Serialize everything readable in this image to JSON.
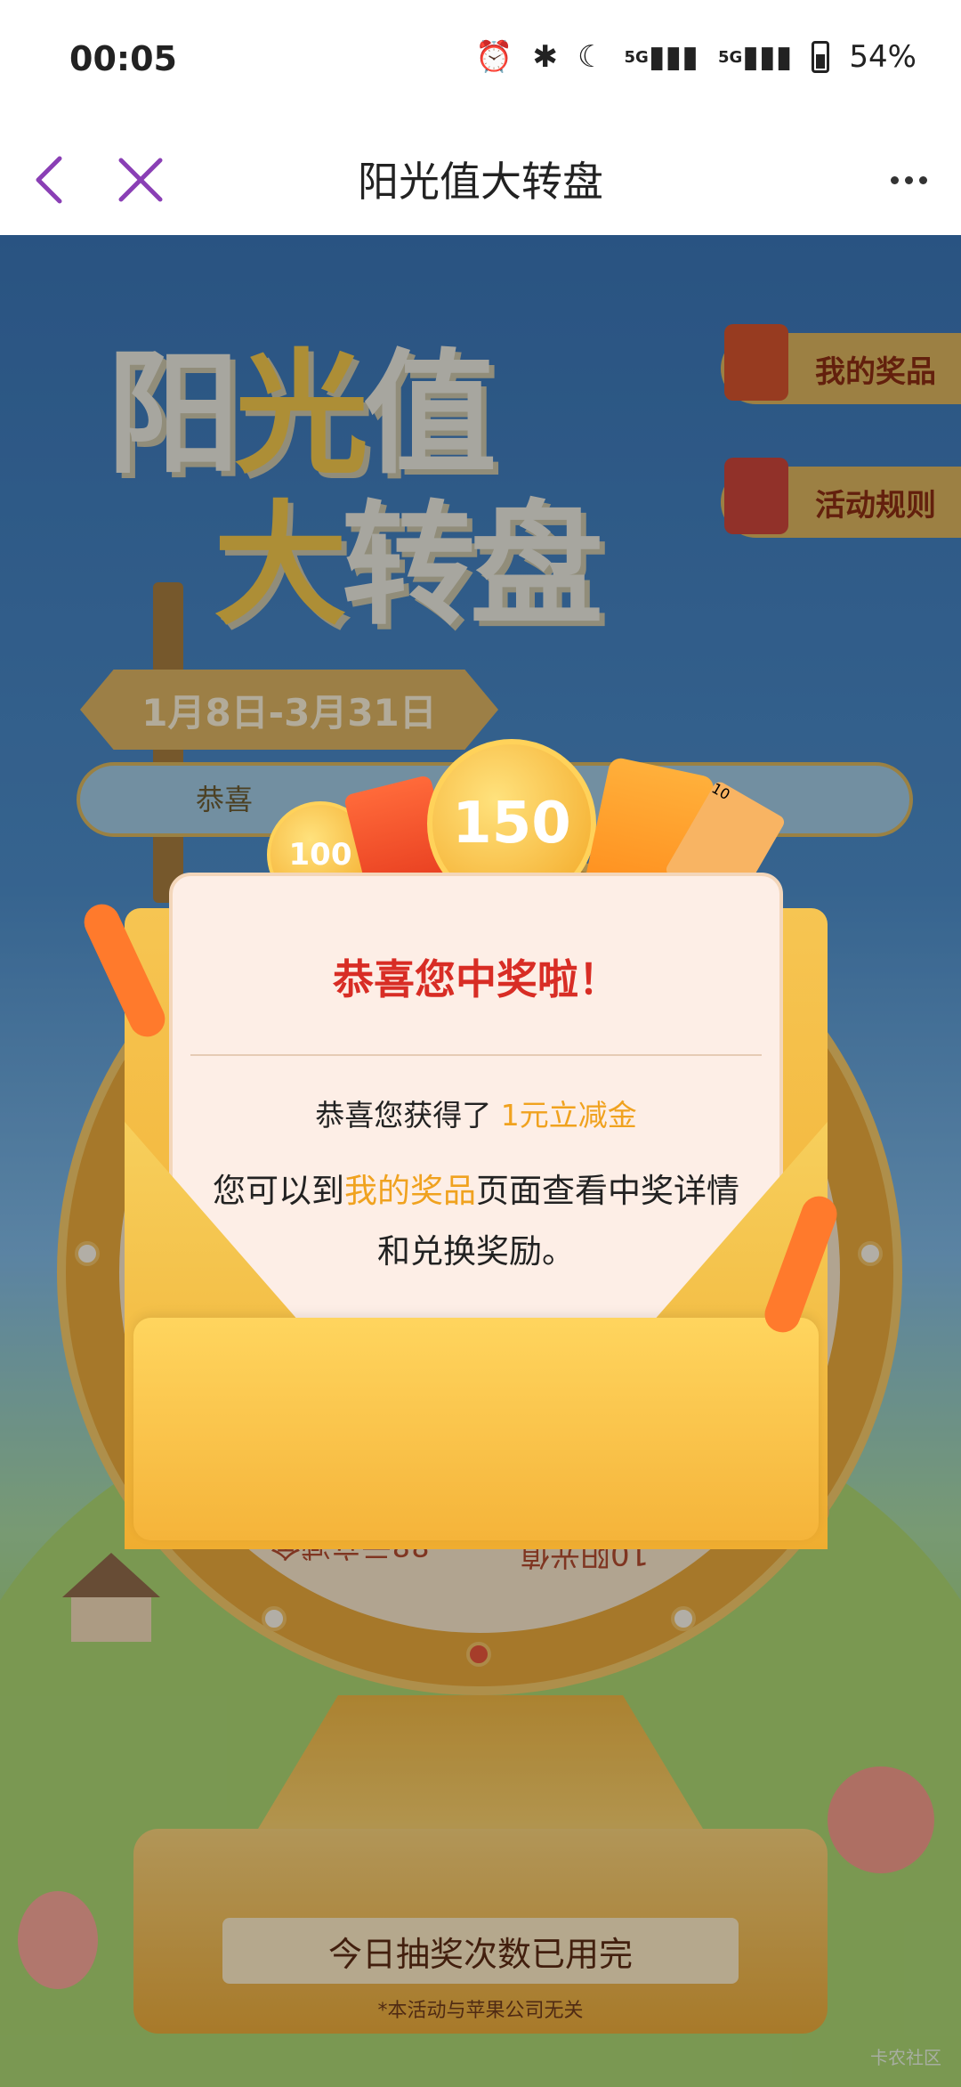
{
  "status_bar": {
    "time": "00:05",
    "net1": "5G",
    "net2": "5G",
    "battery": "54%"
  },
  "nav": {
    "title": "阳光值大转盘"
  },
  "banner": {
    "title_line1_a": "阳",
    "title_line1_b": "光",
    "title_line1_c": "值",
    "title_line2_a": "大",
    "title_line2_b": "转盘",
    "date_range": "1月8日-3月31日",
    "marquee_text": "恭喜"
  },
  "side_buttons": {
    "my_prizes": "我的奖品",
    "rules": "活动规则"
  },
  "rewards": {
    "big_coin": "150",
    "small_coin": "100",
    "ticket": "10"
  },
  "wheel": {
    "segment_a": "88元立减金",
    "segment_b": "10阳光值"
  },
  "modal": {
    "title": "恭喜您中奖啦！",
    "line1_prefix": "恭喜您获得了",
    "line1_prize": "1元立减金",
    "line2_prefix": "您可以到",
    "line2_link": "我的奖品",
    "line2_suffix": "页面查看中奖详情和兑换奖励。"
  },
  "footer": {
    "draw_status": "今日抽奖次数已用完",
    "disclaimer": "*本活动与苹果公司无关",
    "watermark": "卡农社区"
  },
  "colors": {
    "accent_red": "#d82d25",
    "accent_gold": "#f0a21f",
    "nav_purple": "#8a3fb5"
  }
}
